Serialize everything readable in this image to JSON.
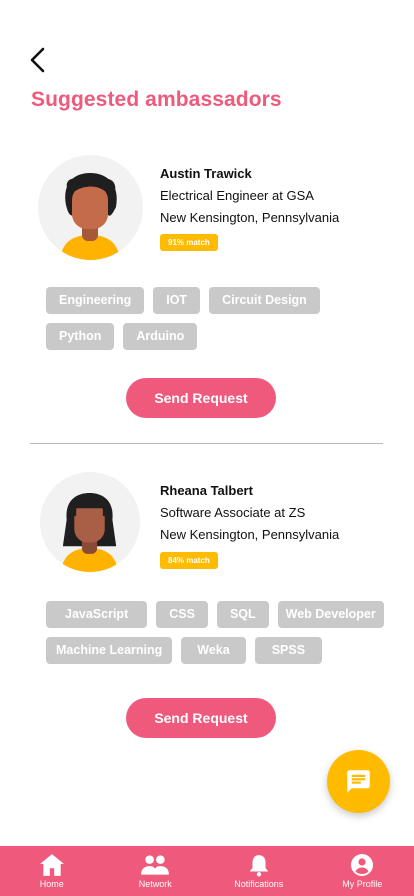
{
  "header": {
    "title": "Suggested ambassadors",
    "back_icon": "chevron-left-icon"
  },
  "ambassadors": [
    {
      "name": "Austin Trawick",
      "job": "Electrical Engineer at GSA",
      "location": "New Kensington, Pennsylvania",
      "match": "91% match",
      "skills": [
        "Engineering",
        "IOT",
        "Circuit Design",
        "Python",
        "Arduino"
      ],
      "button_label": "Send Request"
    },
    {
      "name": "Rheana Talbert",
      "job": "Software Associate at ZS",
      "location": "New Kensington, Pennsylvania",
      "match": "84% match",
      "skills": [
        "JavaScript",
        "CSS",
        "SQL",
        "Web Developer",
        "Machine Learning",
        "Weka",
        "SPSS"
      ],
      "button_label": "Send Request"
    }
  ],
  "chat_button": {
    "icon": "chat-icon"
  },
  "bottom_nav": [
    {
      "label": "Home",
      "icon": "home-icon"
    },
    {
      "label": "Network",
      "icon": "people-icon"
    },
    {
      "label": "Notifications",
      "icon": "bell-icon"
    },
    {
      "label": "My Profile",
      "icon": "account-circle-icon"
    }
  ],
  "colors": {
    "accent": "#ef5a7c",
    "match_badge": "#ffbb00",
    "tag_bg": "#c9c9c9",
    "fab": "#ffbb00"
  }
}
